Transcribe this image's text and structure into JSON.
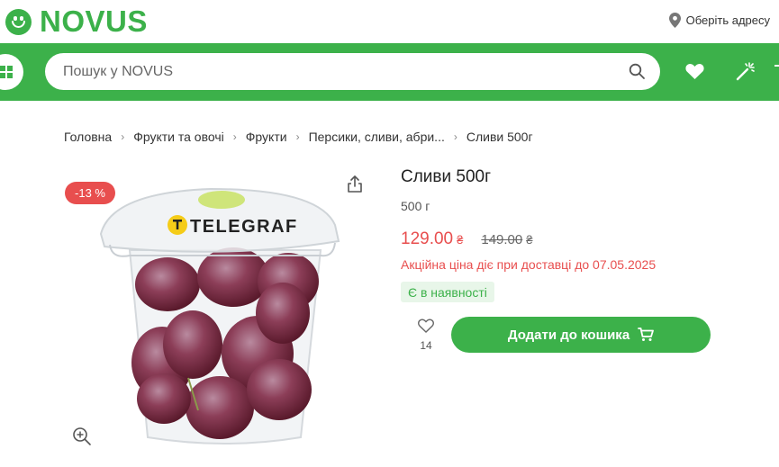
{
  "header": {
    "logo_text": "NOVUS",
    "address_label": "Оберіть адресу"
  },
  "nav": {
    "search_placeholder": "Пошук у NOVUS"
  },
  "breadcrumb": [
    "Головна",
    "Фрукти та овочі",
    "Фрукти",
    "Персики, сливи, абри...",
    "Сливи 500г"
  ],
  "product": {
    "discount_badge": "-13 %",
    "image_label": "TELEGRAF",
    "title": "Сливи 500г",
    "weight": "500 г",
    "price": "129.00",
    "old_price": "149.00",
    "currency": "₴",
    "promo_text": "Акційна ціна діє при доставці до 07.05.2025",
    "stock_status": "Є в наявності",
    "favorites_count": "14",
    "add_to_cart_label": "Додати до кошика"
  },
  "colors": {
    "brand_green": "#3cb14a",
    "sale_red": "#e84e4e",
    "stock_bg": "#e8f6e9"
  },
  "icons": [
    "location-pin-icon",
    "search-icon",
    "heart-icon",
    "magic-wand-icon",
    "cart-icon",
    "share-icon",
    "zoom-in-icon",
    "menu-icon"
  ]
}
